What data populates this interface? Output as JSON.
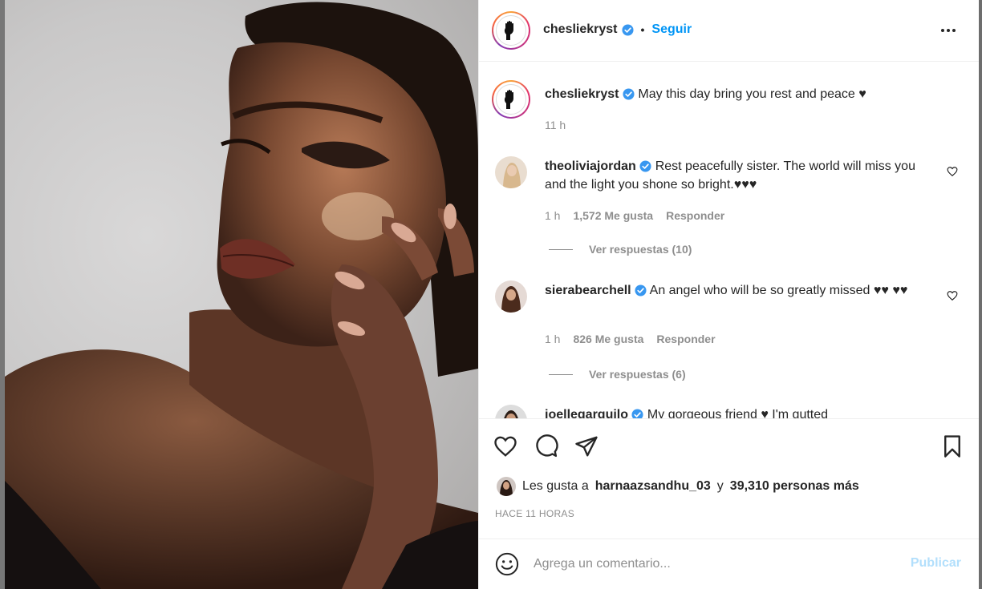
{
  "post": {
    "author": "chesliekryst",
    "follow_label": "Seguir",
    "separator": "•",
    "caption": "May this day bring you rest and peace ♥︎",
    "caption_time": "11 h"
  },
  "comments": [
    {
      "username": "theoliviajordan",
      "text": "Rest peacefully sister. The world will miss you and the light you shone so bright.♥︎♥︎♥︎",
      "time": "1 h",
      "likes": "1,572 Me gusta",
      "reply_label": "Responder",
      "view_replies": "Ver respuestas (10)"
    },
    {
      "username": "sierabearchell",
      "text": "An angel who will be so greatly missed ♥︎♥︎ ♥︎♥︎",
      "time": "1 h",
      "likes": "826 Me gusta",
      "reply_label": "Responder",
      "view_replies": "Ver respuestas (6)"
    },
    {
      "username": "joellegarguilo",
      "text": "My gorgeous friend ♥︎ I'm gutted"
    }
  ],
  "likes": {
    "prefix": "Les gusta a",
    "user": "harnaazsandhu_03",
    "connector": "y",
    "others": "39,310 personas más"
  },
  "time_ago": "HACE 11 HORAS",
  "comment_box": {
    "placeholder": "Agrega un comentario...",
    "publish_label": "Publicar"
  },
  "colors": {
    "link": "#0095f6",
    "verified": "#3897f0",
    "muted": "#8e8e8e",
    "publish_disabled": "#b2dffc"
  },
  "icons": [
    "heart-icon",
    "comment-icon",
    "share-icon",
    "bookmark-icon",
    "more-icon",
    "emoji-icon",
    "verified-icon",
    "raised-fist-icon"
  ]
}
